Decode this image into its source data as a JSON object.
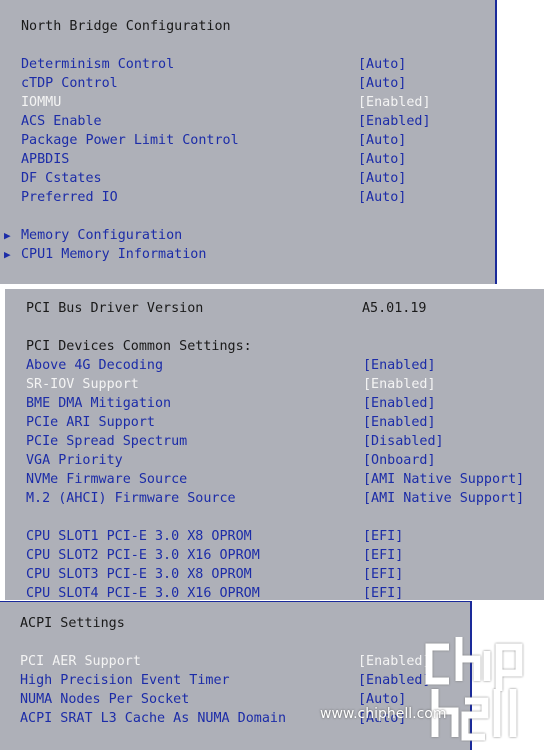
{
  "panel1": {
    "title": "North Bridge Configuration",
    "settings": [
      {
        "label": "Determinism Control",
        "value": "[Auto]"
      },
      {
        "label": "cTDP Control",
        "value": "[Auto]"
      },
      {
        "label": "IOMMU",
        "value": "[Enabled]"
      },
      {
        "label": "ACS Enable",
        "value": "[Enabled]"
      },
      {
        "label": "Package Power Limit Control",
        "value": "[Auto]"
      },
      {
        "label": "APBDIS",
        "value": "[Auto]"
      },
      {
        "label": "DF Cstates",
        "value": "[Auto]"
      },
      {
        "label": "Preferred IO",
        "value": "[Auto]"
      }
    ],
    "submenus": [
      "Memory Configuration",
      "CPU1 Memory Information"
    ]
  },
  "panel2": {
    "version_label": "PCI Bus Driver Version",
    "version_value": "A5.01.19",
    "section_title": "PCI Devices Common Settings:",
    "settings": [
      {
        "label": "Above 4G Decoding",
        "value": "[Enabled]"
      },
      {
        "label": "SR-IOV Support",
        "value": "[Enabled]"
      },
      {
        "label": "BME DMA Mitigation",
        "value": "[Enabled]"
      },
      {
        "label": "PCIe ARI Support",
        "value": "[Enabled]"
      },
      {
        "label": "PCIe Spread Spectrum",
        "value": "[Disabled]"
      },
      {
        "label": "VGA Priority",
        "value": "[Onboard]"
      },
      {
        "label": "NVMe Firmware Source",
        "value": "[AMI Native Support]"
      },
      {
        "label": "M.2 (AHCI) Firmware Source",
        "value": "[AMI Native Support]"
      }
    ],
    "slots": [
      {
        "label": "CPU SLOT1 PCI-E 3.0 X8 OPROM",
        "value": "[EFI]"
      },
      {
        "label": "CPU SLOT2 PCI-E 3.0 X16 OPROM",
        "value": "[EFI]"
      },
      {
        "label": "CPU SLOT3 PCI-E 3.0 X8 OPROM",
        "value": "[EFI]"
      },
      {
        "label": "CPU SLOT4 PCI-E 3.0 X16 OPROM",
        "value": "[EFI]"
      }
    ]
  },
  "panel3": {
    "title": "ACPI Settings",
    "settings": [
      {
        "label": "PCI AER Support",
        "value": "[Enabled]"
      },
      {
        "label": "High Precision Event Timer",
        "value": "[Enabled]"
      },
      {
        "label": "NUMA Nodes Per Socket",
        "value": "[Auto]"
      },
      {
        "label": "ACPI SRAT L3 Cache As NUMA Domain",
        "value": "[Auto]"
      }
    ]
  },
  "watermark": {
    "logo_text": "chip hell",
    "url": "www.chiphell.com"
  },
  "icons": {
    "submenu": "triangle-right-icon"
  }
}
